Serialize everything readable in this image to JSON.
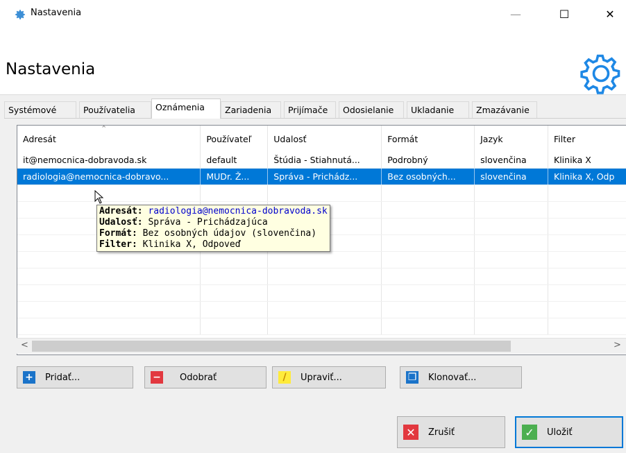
{
  "window": {
    "title": "Nastavenia",
    "icon": "gear-icon",
    "min_glyph": "—",
    "max_glyph": "☐",
    "close_glyph": "✕"
  },
  "header": {
    "title": "Nastavenia",
    "icon": "gear-icon"
  },
  "tabs": [
    {
      "label": "Systémové"
    },
    {
      "label": "Používatelia"
    },
    {
      "label": "Oznámenia",
      "active": true
    },
    {
      "label": "Zariadenia"
    },
    {
      "label": "Prijímače"
    },
    {
      "label": "Odosielanie"
    },
    {
      "label": "Ukladanie"
    },
    {
      "label": "Zmazávanie"
    }
  ],
  "table": {
    "columns": [
      "Adresát",
      "Používateľ",
      "Udalosť",
      "Formát",
      "Jazyk",
      "Filter"
    ],
    "rows": [
      [
        "it@nemocnica-dobravoda.sk",
        "default",
        "Štúdia - Stiahnutá...",
        "Podrobný",
        "slovenčina",
        "Klinika X"
      ],
      [
        "radiologia@nemocnica-dobravo...",
        "MUDr. Ž...",
        "Správa - Prichádz...",
        "Bez osobných...",
        "slovenčina",
        "Klinika X, Odp"
      ]
    ],
    "selected_row": 1
  },
  "tooltip": {
    "recipient_label": "Adresát:",
    "recipient_value": "radiologia@nemocnica-dobravoda.sk",
    "event_label": "Udalosť:",
    "event_value": "Správa - Prichádzajúca",
    "format_label": "Formát:",
    "format_value": "Bez osobných údajov (slovenčina)",
    "filter_label": "Filter:",
    "filter_value": "Klinika X, Odpoveď"
  },
  "actions": {
    "add": "Pridať...",
    "remove": "Odobrať",
    "edit": "Upraviť...",
    "clone": "Klonovať..."
  },
  "footer": {
    "cancel": "Zrušiť",
    "save": "Uložiť"
  },
  "colors": {
    "selection": "#0078d7",
    "tooltip_bg": "#ffffe1",
    "add_icon": "#1a73c9",
    "remove_icon": "#e2383f",
    "edit_icon": "#ffeb3b",
    "save_icon": "#4caf50",
    "cancel_icon": "#e2383f"
  }
}
